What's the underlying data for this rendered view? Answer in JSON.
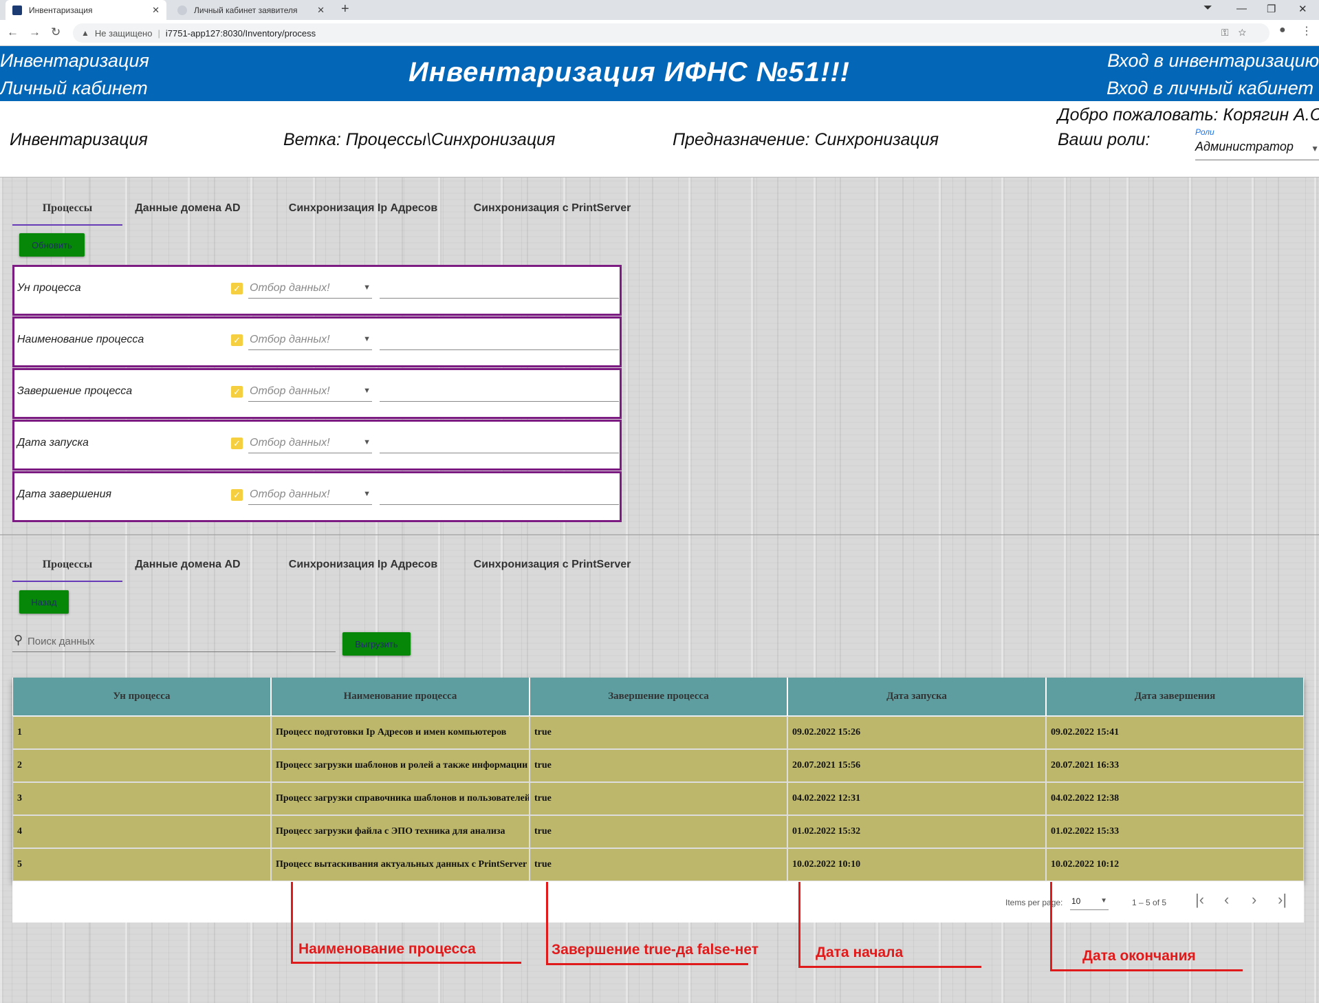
{
  "browser": {
    "tabs": [
      {
        "title": "Инвентаризация",
        "active": true
      },
      {
        "title": "Личный кабинет заявителя",
        "active": false
      }
    ],
    "security_label": "Не защищено",
    "url": "i7751-app127:8030/Inventory/process"
  },
  "header": {
    "left_links": [
      "Инвентаризация",
      "Личный кабинет"
    ],
    "title": "Инвентаризация ИФНС №51!!!",
    "right_links": [
      "Вход в инвентаризацию",
      "Вход в личный кабинет"
    ]
  },
  "info": {
    "section": "Инвентаризация",
    "branch": "Ветка: Процессы\\Синхронизация",
    "purpose": "Предназначение: Синхронизация",
    "welcome": "Добро пожаловать: Корягин А.С.",
    "roles_label": "Ваши роли:",
    "roles_select_label": "Роли",
    "roles_value": "Администратор"
  },
  "tabs": [
    "Процессы",
    "Данные домена AD",
    "Синхронизация Ip Адресов",
    "Синхронизация с PrintServer"
  ],
  "filter": {
    "refresh_label": "Обновить",
    "placeholder": "Отбор данных!",
    "rows": [
      "Ун процесса",
      "Наименование процесса",
      "Завершение процесса",
      "Дата запуска",
      "Дата завершения"
    ]
  },
  "list": {
    "back_label": "Назад",
    "search_placeholder": "Поиск данных",
    "export_label": "Выгрузить",
    "columns": [
      "Ун процесса",
      "Наименование процесса",
      "Завершение процесса",
      "Дата запуска",
      "Дата завершения"
    ],
    "rows": [
      [
        "1",
        "Процесс подготовки Ip Адресов и имен компьютеров",
        "true",
        "09.02.2022 15:26",
        "09.02.2022 15:41"
      ],
      [
        "2",
        "Процесс загрузки шаблонов и ролей а также информации",
        "true",
        "20.07.2021 15:56",
        "20.07.2021 16:33"
      ],
      [
        "3",
        "Процесс загрузки справочника шаблонов и пользователей",
        "true",
        "04.02.2022 12:31",
        "04.02.2022 12:38"
      ],
      [
        "4",
        "Процесс загрузки файла с ЭПО техника для анализа",
        "true",
        "01.02.2022 15:32",
        "01.02.2022 15:33"
      ],
      [
        "5",
        "Процесс вытаскивания актуальных данных с PrintServer",
        "true",
        "10.02.2022 10:10",
        "10.02.2022 10:12"
      ]
    ]
  },
  "paginator": {
    "items_per_page_label": "Items per page:",
    "page_size": "10",
    "range": "1 – 5 of 5"
  },
  "annotations": [
    "Наименование процесса",
    "Завершение true-да false-нет",
    "Дата начала",
    "Дата окончания"
  ],
  "colors": {
    "header_bg": "#0466b6",
    "button_green": "#078707",
    "filter_border": "#7c1c82",
    "table_header": "#5f9ea0",
    "table_row": "#bdb76b",
    "annotation": "#e01a1a"
  }
}
